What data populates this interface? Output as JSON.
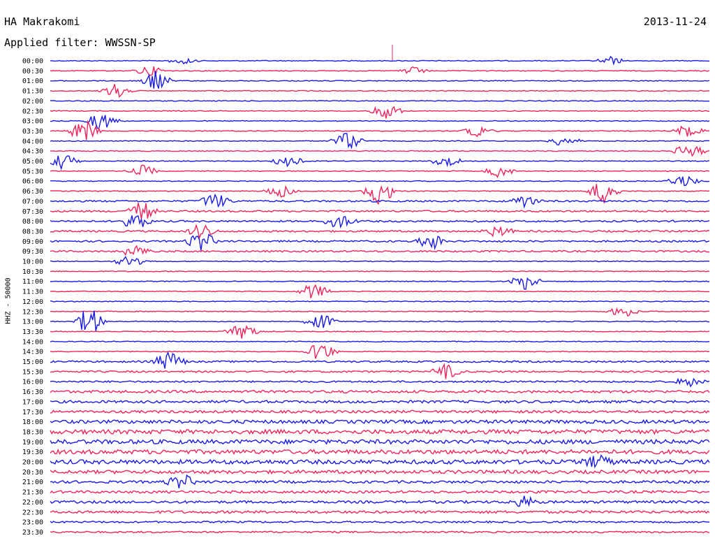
{
  "header": {
    "station": "HA Makrakomi",
    "date": "2013-11-24",
    "filter": "Applied filter: WWSSN-SP",
    "scale_label": "HHZ - 50000"
  },
  "colors": {
    "trace_a": "#1a1ae6",
    "trace_b": "#f0245a"
  },
  "chart_data": {
    "type": "line",
    "title": "HA Makrakomi",
    "subtitle": "Applied filter: WWSSN-SP",
    "ylabel": "HHZ - 50000",
    "xlabel": "",
    "y_tick_labels": [
      "00:00",
      "00:30",
      "01:00",
      "01:30",
      "02:00",
      "02:30",
      "03:00",
      "03:30",
      "04:00",
      "04:30",
      "05:00",
      "05:30",
      "06:00",
      "06:30",
      "07:00",
      "07:30",
      "08:00",
      "08:30",
      "09:00",
      "09:30",
      "10:00",
      "10:30",
      "11:00",
      "11:30",
      "12:00",
      "12:30",
      "13:00",
      "13:30",
      "14:00",
      "14:30",
      "15:00",
      "15:30",
      "16:00",
      "16:30",
      "17:00",
      "17:30",
      "18:00",
      "18:30",
      "19:00",
      "19:30",
      "20:00",
      "20:30",
      "21:00",
      "21:30",
      "22:00",
      "22:30",
      "23:00",
      "23:30"
    ],
    "series_color_cycle": [
      "#1a1ae6",
      "#f0245a"
    ],
    "row_noise_level": [
      1,
      1,
      1,
      1,
      1,
      1,
      1,
      1,
      1,
      1,
      1,
      1,
      1,
      1,
      2,
      2,
      2,
      2,
      2,
      2,
      1,
      1,
      1,
      1,
      1,
      1,
      1,
      1,
      1,
      1,
      2,
      2,
      2,
      3,
      3,
      3,
      4,
      5,
      5,
      5,
      5,
      4,
      3,
      3,
      3,
      3,
      2,
      2
    ],
    "events": [
      {
        "row": 0,
        "t": 0.2,
        "amp": 2
      },
      {
        "row": 0,
        "t": 0.85,
        "amp": 2
      },
      {
        "row": 1,
        "t": 0.15,
        "amp": 3
      },
      {
        "row": 1,
        "t": 0.55,
        "amp": 2
      },
      {
        "row": 2,
        "t": 0.16,
        "amp": 5
      },
      {
        "row": 3,
        "t": 0.1,
        "amp": 4
      },
      {
        "row": 5,
        "t": 0.51,
        "amp": 4
      },
      {
        "row": 6,
        "t": 0.08,
        "amp": 5
      },
      {
        "row": 7,
        "t": 0.05,
        "amp": 6
      },
      {
        "row": 7,
        "t": 0.65,
        "amp": 3
      },
      {
        "row": 7,
        "t": 0.97,
        "amp": 4
      },
      {
        "row": 8,
        "t": 0.45,
        "amp": 5
      },
      {
        "row": 8,
        "t": 0.78,
        "amp": 3
      },
      {
        "row": 9,
        "t": 0.97,
        "amp": 4
      },
      {
        "row": 10,
        "t": 0.02,
        "amp": 4
      },
      {
        "row": 10,
        "t": 0.36,
        "amp": 3
      },
      {
        "row": 10,
        "t": 0.6,
        "amp": 3
      },
      {
        "row": 11,
        "t": 0.14,
        "amp": 3
      },
      {
        "row": 11,
        "t": 0.68,
        "amp": 3
      },
      {
        "row": 12,
        "t": 0.96,
        "amp": 3
      },
      {
        "row": 13,
        "t": 0.5,
        "amp": 7
      },
      {
        "row": 13,
        "t": 0.84,
        "amp": 6
      },
      {
        "row": 13,
        "t": 0.35,
        "amp": 3
      },
      {
        "row": 14,
        "t": 0.25,
        "amp": 4
      },
      {
        "row": 14,
        "t": 0.72,
        "amp": 3
      },
      {
        "row": 15,
        "t": 0.14,
        "amp": 5
      },
      {
        "row": 16,
        "t": 0.44,
        "amp": 4
      },
      {
        "row": 16,
        "t": 0.13,
        "amp": 4
      },
      {
        "row": 17,
        "t": 0.23,
        "amp": 4
      },
      {
        "row": 17,
        "t": 0.68,
        "amp": 3
      },
      {
        "row": 18,
        "t": 0.23,
        "amp": 5
      },
      {
        "row": 18,
        "t": 0.58,
        "amp": 4
      },
      {
        "row": 19,
        "t": 0.13,
        "amp": 3
      },
      {
        "row": 20,
        "t": 0.12,
        "amp": 3
      },
      {
        "row": 22,
        "t": 0.72,
        "amp": 4
      },
      {
        "row": 23,
        "t": 0.4,
        "amp": 4
      },
      {
        "row": 26,
        "t": 0.06,
        "amp": 7
      },
      {
        "row": 26,
        "t": 0.41,
        "amp": 4
      },
      {
        "row": 27,
        "t": 0.29,
        "amp": 5
      },
      {
        "row": 25,
        "t": 0.87,
        "amp": 3
      },
      {
        "row": 29,
        "t": 0.41,
        "amp": 5
      },
      {
        "row": 30,
        "t": 0.18,
        "amp": 5
      },
      {
        "row": 31,
        "t": 0.6,
        "amp": 4
      },
      {
        "row": 32,
        "t": 0.97,
        "amp": 3
      },
      {
        "row": 40,
        "t": 0.83,
        "amp": 4
      },
      {
        "row": 42,
        "t": 0.2,
        "amp": 4
      },
      {
        "row": 44,
        "t": 0.72,
        "amp": 3
      }
    ]
  }
}
